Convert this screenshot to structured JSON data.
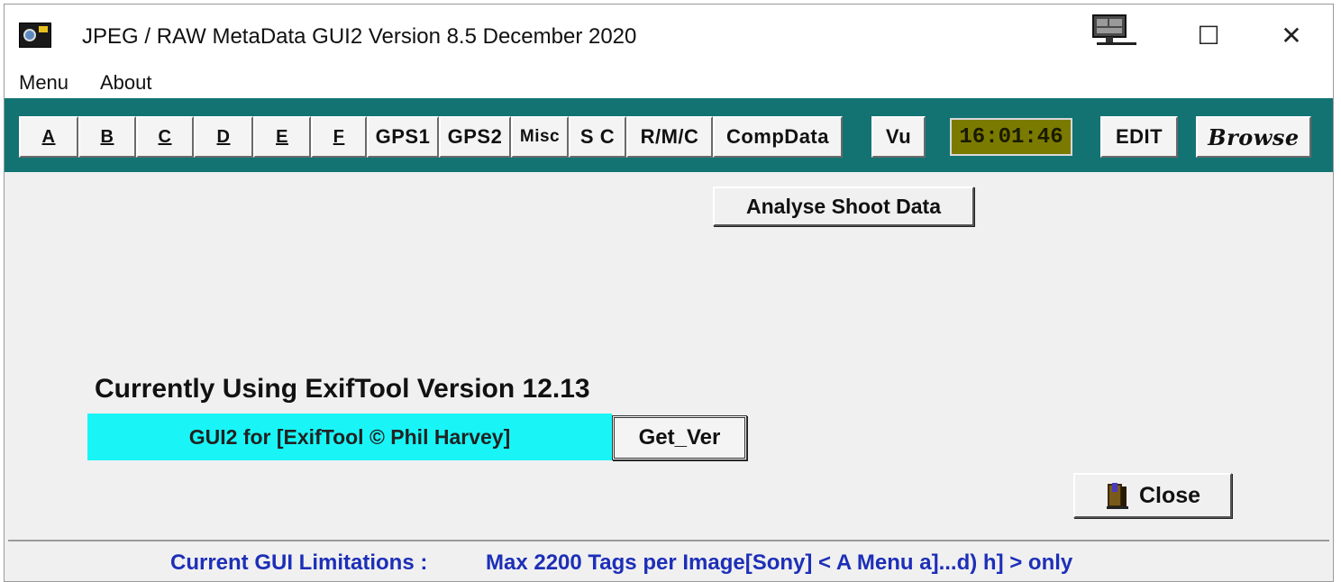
{
  "window": {
    "title": "JPEG / RAW MetaData  GUI2  Version 8.5  December 2020",
    "controls": {
      "maximize": "☐",
      "close": "✕"
    }
  },
  "menu": [
    {
      "label": "Menu"
    },
    {
      "label": "About"
    }
  ],
  "toolbar": {
    "tab_a": "A",
    "tab_b": "B",
    "tab_c": "C",
    "tab_d": "D",
    "tab_e": "E",
    "tab_f": "F",
    "gps1": "GPS1",
    "gps2": "GPS2",
    "misc": "Misc",
    "sc": "S C",
    "rmc": "R/M/C",
    "compdata": "CompData",
    "vu": "Vu",
    "clock": "16:01:46",
    "edit": "EDIT",
    "browse": "Browse"
  },
  "main": {
    "analyse_button": "Analyse Shoot Data",
    "exiftool_version_label": "Currently Using ExifTool Version  12.13",
    "gui_banner": "GUI2  for [ExifTool  ©  Phil Harvey]",
    "get_ver_button": "Get_Ver",
    "close_button": "Close"
  },
  "status": {
    "label": "Current GUI Limitations :",
    "message": "Max 2200 Tags per Image[Sony] < A Menu a]...d)  h] > only"
  },
  "colors": {
    "toolbar_bg": "#137373",
    "clock_bg": "#7a7a00",
    "banner_bg": "#19f5f7",
    "status_text": "#1d2fb8"
  }
}
